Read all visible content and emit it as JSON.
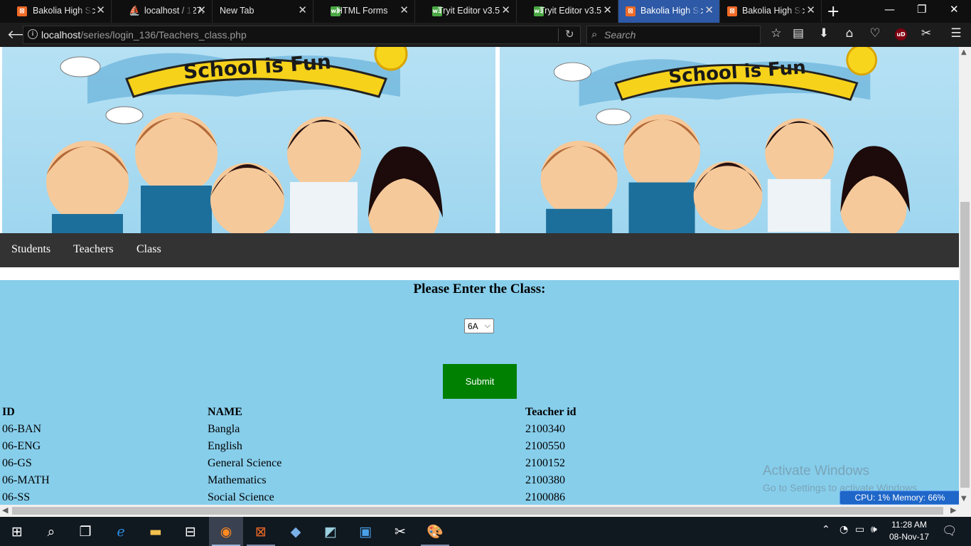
{
  "browser": {
    "tabs": [
      {
        "label": "Bakolia High Sc",
        "icon": "xampp-icon",
        "active": false
      },
      {
        "label": "localhost / 127.",
        "icon": "phpmyadmin-icon",
        "active": false
      },
      {
        "label": "New Tab",
        "icon": "",
        "active": false
      },
      {
        "label": "HTML Forms",
        "icon": "w3schools-icon",
        "active": false
      },
      {
        "label": "Tryit Editor v3.5",
        "icon": "w3schools-icon",
        "active": false
      },
      {
        "label": "Tryit Editor v3.5",
        "icon": "w3schools-icon",
        "active": false
      },
      {
        "label": "Bakolia High Sc",
        "icon": "xampp-icon",
        "active": true
      },
      {
        "label": "Bakolia High Sc",
        "icon": "xampp-icon",
        "active": false
      }
    ],
    "url_host": "localhost",
    "url_path": "/series/login_136/Teachers_class.php",
    "search_placeholder": "Search"
  },
  "page": {
    "banner_text": "School is Fun",
    "menu": [
      "Students",
      "Teachers",
      "Class"
    ],
    "prompt": "Please Enter the Class:",
    "class_select": {
      "value": "6A"
    },
    "submit_label": "Submit",
    "table": {
      "headers": [
        "ID",
        "NAME",
        "Teacher id"
      ],
      "rows": [
        [
          "06-BAN",
          "Bangla",
          "2100340"
        ],
        [
          "06-ENG",
          "English",
          "2100550"
        ],
        [
          "06-GS",
          "General Science",
          "2100152"
        ],
        [
          "06-MATH",
          "Mathematics",
          "2100380"
        ],
        [
          "06-SS",
          "Social Science",
          "2100086"
        ]
      ]
    }
  },
  "overlay": {
    "watermark_line1": "Activate Windows",
    "watermark_line2": "Go to Settings to activate Windows.",
    "cpu_memory": "CPU: 1%   Memory: 66%"
  },
  "taskbar": {
    "time": "11:28 AM",
    "date": "08-Nov-17"
  },
  "colors": {
    "page_bg": "#87ceeb",
    "menubar_bg": "#333333",
    "submit_bg": "#008000",
    "active_tab": "#2d59a6"
  }
}
